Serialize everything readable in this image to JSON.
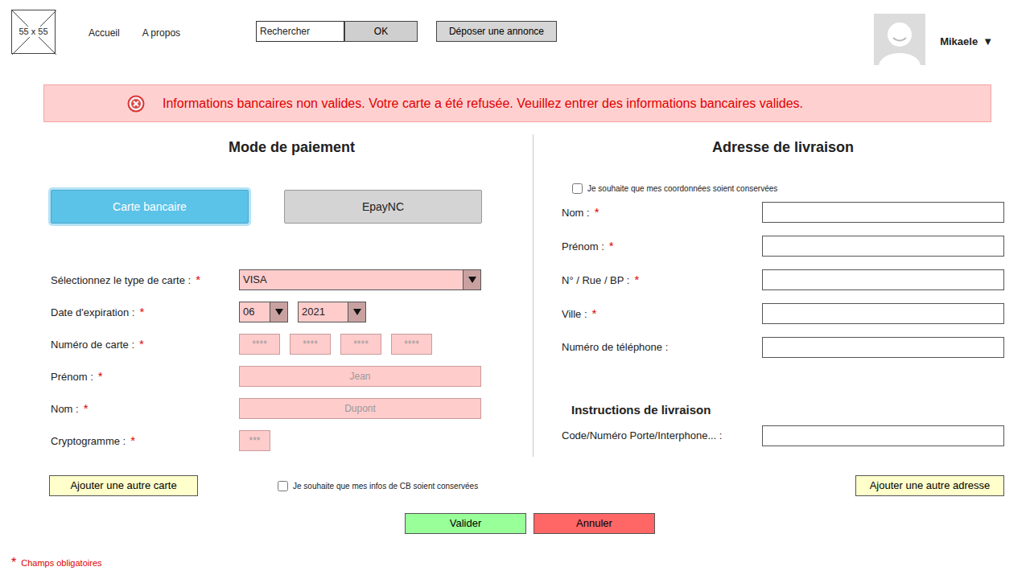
{
  "header": {
    "logo": "55 x 55",
    "nav": [
      {
        "label": "Accueil"
      },
      {
        "label": "A propos"
      }
    ],
    "search": {
      "placeholder": "Rechercher",
      "button": "OK"
    },
    "post_button": "Déposer une annonce",
    "user": {
      "name": "Mikaele",
      "caret": "▼"
    }
  },
  "alert": {
    "message": "Informations bancaires non valides. Votre carte a été refusée. Veuillez entrer des informations bancaires valides."
  },
  "required_mark": "*",
  "payment": {
    "title": "Mode de paiement",
    "methods": [
      {
        "label": "Carte bancaire",
        "selected": true
      },
      {
        "label": "EpayNC",
        "selected": false
      }
    ],
    "fields": [
      {
        "kind": "select",
        "label": "Sélectionnez le type de carte :",
        "value": "VISA",
        "required": true,
        "invalid": true
      },
      {
        "kind": "date",
        "label": "Date d'expiration :",
        "values": [
          "06",
          "2021"
        ],
        "required": true,
        "invalid": true
      },
      {
        "kind": "segments",
        "label": "Numéro de carte :",
        "placeholders": [
          "****",
          "****",
          "****",
          "****"
        ],
        "required": true,
        "invalid": true
      },
      {
        "kind": "text",
        "label": "Prénom :",
        "placeholder": "Jean",
        "required": true,
        "invalid": true
      },
      {
        "kind": "text",
        "label": "Nom :",
        "placeholder": "Dupont",
        "required": true,
        "invalid": true
      },
      {
        "kind": "code",
        "label": "Cryptogramme :",
        "placeholder": "***",
        "required": true,
        "invalid": true
      }
    ],
    "add_button": "Ajouter une autre carte",
    "save": {
      "label": "Je souhaite que mes infos de CB soient conservées",
      "checked": false
    }
  },
  "address": {
    "title": "Adresse de livraison",
    "save": {
      "label": "Je souhaite que mes coordonnées soient conservées",
      "checked": false
    },
    "fields": [
      {
        "label": "Nom :",
        "required": true
      },
      {
        "label": "Prénom :",
        "required": true
      },
      {
        "label": "N° / Rue / BP :",
        "required": true
      },
      {
        "label": "Ville :",
        "required": true
      },
      {
        "label": "Numéro de téléphone :",
        "required": false
      }
    ],
    "instructions": {
      "title": "Instructions de livraison",
      "fields": [
        {
          "label": "Code/Numéro Porte/Interphone... :",
          "required": false
        }
      ]
    },
    "add_button": "Ajouter une autre adresse"
  },
  "actions": [
    {
      "label": "Valider",
      "color": "#99ff99"
    },
    {
      "label": "Annuler",
      "color": "#ff6666"
    }
  ],
  "legend": {
    "mark": "*",
    "text": "Champs obligatoires"
  }
}
